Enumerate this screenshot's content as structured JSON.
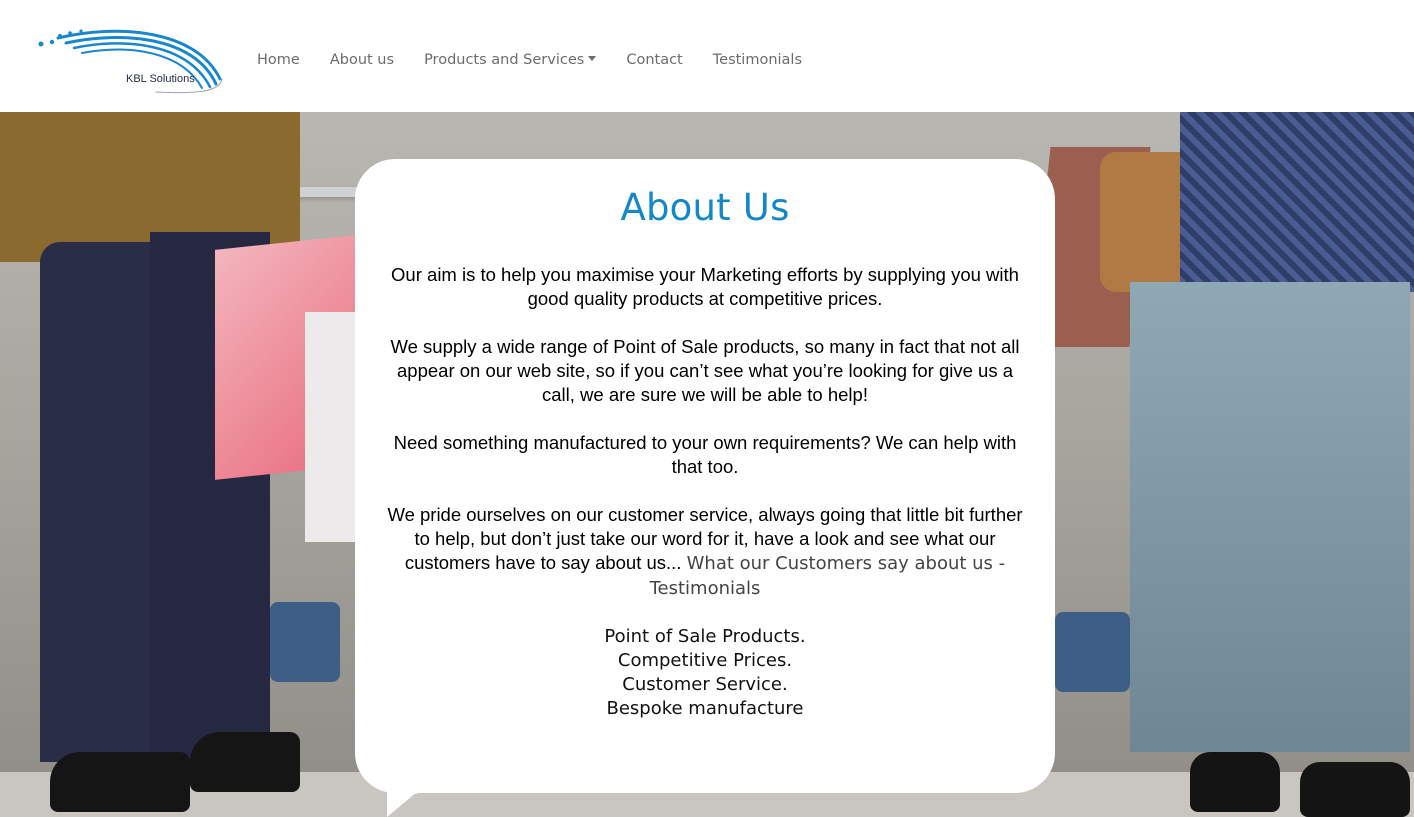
{
  "brand": {
    "logo_text": "KBL Solutions",
    "accent_color": "#1387c9"
  },
  "nav": {
    "items": [
      {
        "label": "Home",
        "icon": ""
      },
      {
        "label": "About us",
        "icon": ""
      },
      {
        "label": "Products and Services",
        "icon": "caret-down-icon"
      },
      {
        "label": "Contact",
        "icon": ""
      },
      {
        "label": "Testimonials",
        "icon": ""
      }
    ]
  },
  "about": {
    "title": "About Us",
    "paragraphs": [
      "Our aim is to help you maximise your Marketing efforts by supplying you with good quality products at competitive prices.",
      "We supply a wide range of Point of Sale products, so many in fact that not all appear on our web site, so if you can’t see what you’re looking for give us a call, we are sure we will be able to help!",
      "Need something manufactured to your own requirements? We can help with that too.",
      "We pride ourselves on our customer service, always going that little bit further to help, but don’t just take our word for it, have a look and see what our customers have to say about us..."
    ],
    "link_text": "What our Customers say about us - Testimonials",
    "taglines": [
      "Point of Sale Products.",
      "Competitive Prices.",
      "Customer Service.",
      "Bespoke manufacture"
    ]
  }
}
